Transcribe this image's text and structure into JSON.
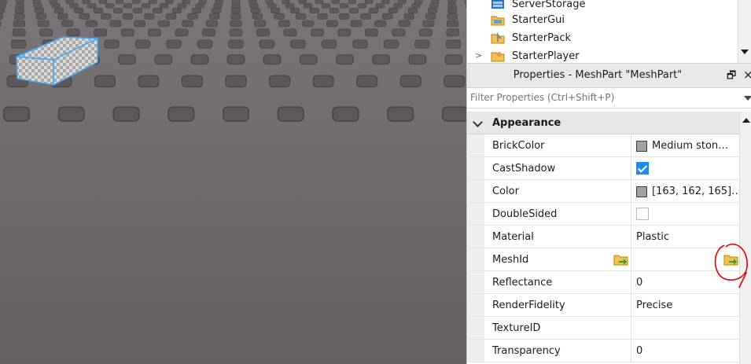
{
  "explorer": {
    "items": [
      {
        "label": "ServerStorage",
        "icon": "server-storage-icon"
      },
      {
        "label": "StarterGui",
        "icon": "starter-gui-icon"
      },
      {
        "label": "StarterPack",
        "icon": "starter-pack-icon"
      },
      {
        "label": "StarterPlayer",
        "icon": "starter-player-icon",
        "expander": ">"
      }
    ]
  },
  "properties": {
    "title": "Properties - MeshPart \"MeshPart\"",
    "restore_glyph": "🗗",
    "close_glyph": "×",
    "filter_placeholder": "Filter Properties (Ctrl+Shift+P)",
    "category": "Appearance",
    "rows": [
      {
        "name": "BrickColor",
        "value": "Medium ston…",
        "kind": "swatch",
        "swatch_color": "#a3a2a5"
      },
      {
        "name": "CastShadow",
        "kind": "checkbox",
        "checked": true
      },
      {
        "name": "Color",
        "value": "[163, 162, 165]…",
        "kind": "swatch",
        "swatch_color": "#a3a2a5"
      },
      {
        "name": "DoubleSided",
        "kind": "checkbox",
        "checked": false
      },
      {
        "name": "Material",
        "value": "Plastic",
        "kind": "text"
      },
      {
        "name": "MeshId",
        "value": "",
        "kind": "asset"
      },
      {
        "name": "Reflectance",
        "value": "0",
        "kind": "text"
      },
      {
        "name": "RenderFidelity",
        "value": "Precise",
        "kind": "text"
      },
      {
        "name": "TextureID",
        "value": "",
        "kind": "text"
      },
      {
        "name": "Transparency",
        "value": "0",
        "kind": "text"
      }
    ]
  },
  "colors": {
    "checkbox_accent": "#1d8ef0",
    "annotation": "#e00000",
    "selection_outline": "#3aa8ff",
    "baseplate": "#6a6568"
  }
}
